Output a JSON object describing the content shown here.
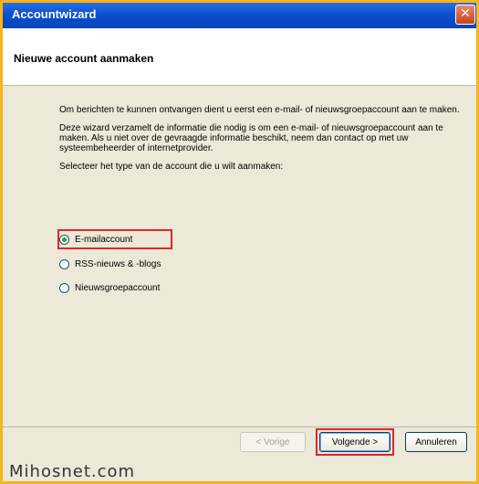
{
  "window": {
    "title": "Accountwizard",
    "close_glyph": "✕"
  },
  "header": {
    "title": "Nieuwe account aanmaken"
  },
  "intro": [
    "Om berichten te kunnen ontvangen dient u eerst een e-mail- of nieuwsgroepaccount aan te maken.",
    "Deze wizard verzamelt de informatie die nodig is om een e-mail- of nieuwsgroepaccount aan te maken. Als u niet over de gevraagde informatie beschikt, neem dan contact op met uw systeembeheerder of internetprovider.",
    "Selecteer het type van de account die u wilt aanmaken:"
  ],
  "options": [
    {
      "label": "E-mailaccount",
      "checked": true
    },
    {
      "label": "RSS-nieuws & -blogs",
      "checked": false
    },
    {
      "label": "Nieuwsgroepaccount",
      "checked": false
    }
  ],
  "buttons": {
    "back": "< Vorige",
    "next": "Volgende >",
    "cancel": "Annuleren"
  },
  "watermark": "Mihosnet.com",
  "colors": {
    "titlebar": "#0b4fd0",
    "highlight": "#e0262a",
    "frame": "#f6b51c"
  }
}
